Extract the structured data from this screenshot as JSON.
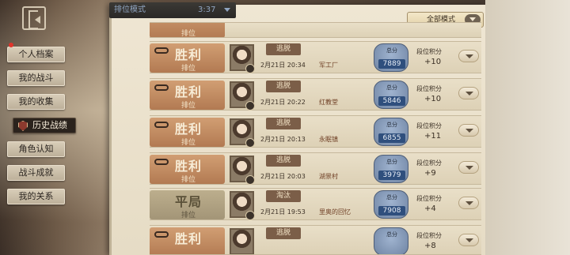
{
  "header": {
    "tab_title": "排位模式",
    "timer": "3:37"
  },
  "filter": {
    "label": "全部模式"
  },
  "side_menu": {
    "items": [
      {
        "label": "个人档案",
        "selected": false
      },
      {
        "label": "我的战斗",
        "selected": false
      },
      {
        "label": "我的收集",
        "selected": false
      },
      {
        "label": "历史战绩",
        "selected": true
      },
      {
        "label": "角色认知",
        "selected": false
      },
      {
        "label": "战斗成就",
        "selected": false
      },
      {
        "label": "我的关系",
        "selected": false
      }
    ]
  },
  "matches": [
    {
      "result": "",
      "mode": "排位",
      "outcome": "",
      "time": "",
      "map": "",
      "score_label": "",
      "score": "",
      "rank_label": "",
      "rank_delta": ""
    },
    {
      "result": "胜利",
      "mode": "排位",
      "outcome": "逃脱",
      "time": "2月21日 20:34",
      "map": "军工厂",
      "score_label": "总分",
      "score": "7889",
      "rank_label": "段位积分",
      "rank_delta": "+10"
    },
    {
      "result": "胜利",
      "mode": "排位",
      "outcome": "逃脱",
      "time": "2月21日 20:22",
      "map": "红教堂",
      "score_label": "总分",
      "score": "5846",
      "rank_label": "段位积分",
      "rank_delta": "+10"
    },
    {
      "result": "胜利",
      "mode": "排位",
      "outcome": "逃脱",
      "time": "2月21日 20:13",
      "map": "永眠镇",
      "score_label": "总分",
      "score": "6855",
      "rank_label": "段位积分",
      "rank_delta": "+11"
    },
    {
      "result": "胜利",
      "mode": "排位",
      "outcome": "逃脱",
      "time": "2月21日 20:03",
      "map": "湖景村",
      "score_label": "总分",
      "score": "3979",
      "rank_label": "段位积分",
      "rank_delta": "+9"
    },
    {
      "result": "平局",
      "mode": "排位",
      "outcome": "淘汰",
      "time": "2月21日 19:53",
      "map": "里奥的回忆",
      "score_label": "总分",
      "score": "7908",
      "rank_label": "段位积分",
      "rank_delta": "+4"
    },
    {
      "result": "胜利",
      "mode": "",
      "outcome": "逃脱",
      "time": "",
      "map": "",
      "score_label": "总分",
      "score": "",
      "rank_label": "段位积分",
      "rank_delta": "+8"
    }
  ],
  "colors": {
    "win_badge": "#c28a60",
    "draw_badge": "#b0a283",
    "score_badge": "#6f84a3"
  }
}
